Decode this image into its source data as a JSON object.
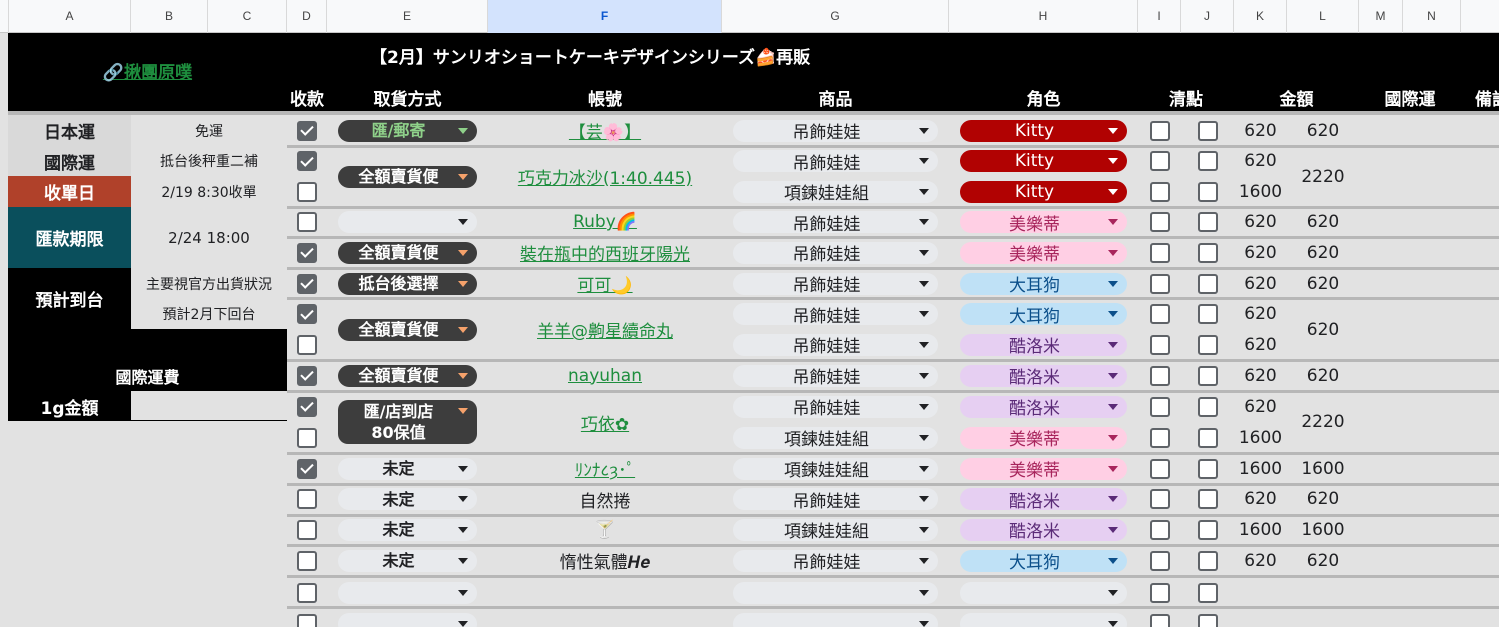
{
  "columns": [
    "A",
    "B",
    "C",
    "D",
    "E",
    "F",
    "G",
    "H",
    "I",
    "J",
    "K",
    "L",
    "M",
    "N"
  ],
  "title": "【2月】サンリオショートケーキデザインシリーズ🍰再販",
  "link_label": "🔗揪團原噗",
  "headers": {
    "paid": "收款",
    "pickup": "取貨方式",
    "account": "帳號",
    "product": "商品",
    "character": "角色",
    "check": "清點",
    "amount": "金額",
    "intl": "國際運",
    "note": "備註"
  },
  "info": {
    "jp_ship_label": "日本運",
    "jp_ship_value": "免運",
    "intl_label": "國際運",
    "intl_value": "抵台後秤重二補",
    "close_label": "收單日",
    "close_value": "2/19 8:30收單",
    "pay_label": "匯款期限",
    "pay_value": "2/24 18:00",
    "eta_label": "預計到台",
    "eta_value1": "主要視官方出貨狀況",
    "eta_value2": "預計2月下回台",
    "intl_fee_label": "國際運費",
    "per_g_label": "1g金額"
  },
  "orders": [
    {
      "paid": true,
      "pickup": "匯/郵寄",
      "account": "【芸🌸】",
      "product": "吊飾娃娃",
      "character": "Kitty",
      "qty": "620",
      "amount": "620"
    },
    {
      "paid": true,
      "pickup": "全額賣貨便",
      "account": "巧克力冰沙(1:40.445)",
      "product": "吊飾娃娃",
      "character": "Kitty",
      "qty": "620",
      "amount": "2220"
    },
    {
      "paid": false,
      "pickup": "",
      "account": "",
      "product": "項鍊娃娃組",
      "character": "Kitty",
      "qty": "1600",
      "amount": ""
    },
    {
      "paid": false,
      "pickup": "",
      "account": "Ruby🌈",
      "product": "吊飾娃娃",
      "character": "美樂蒂",
      "qty": "620",
      "amount": "620"
    },
    {
      "paid": true,
      "pickup": "全額賣貨便",
      "account": "裝在瓶中的西班牙陽光",
      "product": "吊飾娃娃",
      "character": "美樂蒂",
      "qty": "620",
      "amount": "620"
    },
    {
      "paid": true,
      "pickup": "抵台後選擇",
      "account": "可可🌙",
      "product": "吊飾娃娃",
      "character": "大耳狗",
      "qty": "620",
      "amount": "620"
    },
    {
      "paid": true,
      "pickup": "全額賣貨便",
      "account": "羊羊@齁星續命丸",
      "product": "吊飾娃娃",
      "character": "大耳狗",
      "qty": "620",
      "amount": "620"
    },
    {
      "paid": false,
      "pickup": "",
      "account": "",
      "product": "吊飾娃娃",
      "character": "酷洛米",
      "qty": "620",
      "amount": "620"
    },
    {
      "paid": true,
      "pickup": "全額賣貨便",
      "account": "nayuhan",
      "product": "吊飾娃娃",
      "character": "酷洛米",
      "qty": "620",
      "amount": "620"
    },
    {
      "paid": true,
      "pickup": "匯/店到店\n80保值",
      "account": "巧依✿",
      "product": "吊飾娃娃",
      "character": "酷洛米",
      "qty": "620",
      "amount": "2220"
    },
    {
      "paid": false,
      "pickup": "",
      "account": "",
      "product": "項鍊娃娃組",
      "character": "美樂蒂",
      "qty": "1600",
      "amount": ""
    },
    {
      "paid": true,
      "pickup": "未定",
      "account": "ﾘﾝﾅ८ȝ･ﾟ",
      "product": "項鍊娃娃組",
      "character": "美樂蒂",
      "qty": "1600",
      "amount": "1600"
    },
    {
      "paid": false,
      "pickup": "未定",
      "account": "自然捲",
      "product": "吊飾娃娃",
      "character": "酷洛米",
      "qty": "620",
      "amount": "620"
    },
    {
      "paid": false,
      "pickup": "未定",
      "account": "🍸",
      "product": "項鍊娃娃組",
      "character": "酷洛米",
      "qty": "1600",
      "amount": "1600"
    },
    {
      "paid": false,
      "pickup": "未定",
      "account": "惰性氣體𝑯𝒆",
      "product": "吊飾娃娃",
      "character": "大耳狗",
      "qty": "620",
      "amount": "620"
    }
  ],
  "colors": {
    "kitty": "#b10202",
    "melody": "#ffcfe4",
    "cinna": "#bfe1f6",
    "kuromi": "#e6cff2",
    "pickup_dark": "#3d3d3d",
    "pickup_arrow": "#f6a26b",
    "closing": "#b0412a",
    "payteal": "#0a4f5c"
  }
}
